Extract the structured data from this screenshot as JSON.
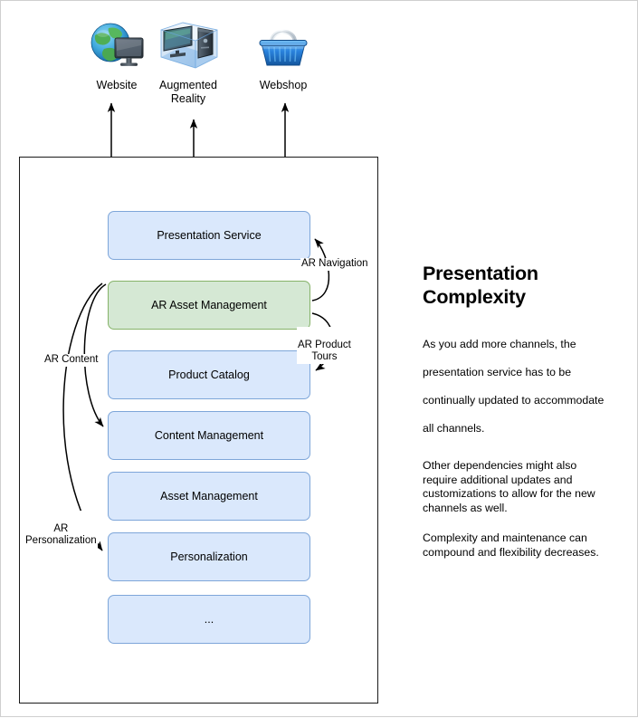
{
  "channels": [
    {
      "id": "website",
      "label": "Website",
      "icon": "globe-monitor-icon"
    },
    {
      "id": "ar",
      "label": "Augmented\nReality",
      "icon": "ar-projection-icon"
    },
    {
      "id": "webshop",
      "label": "Webshop",
      "icon": "shopping-basket-icon"
    }
  ],
  "services": [
    {
      "id": "presentation-service",
      "label": "Presentation Service",
      "highlight": false
    },
    {
      "id": "ar-asset-management",
      "label": "AR Asset Management",
      "highlight": true
    },
    {
      "id": "product-catalog",
      "label": "Product Catalog",
      "highlight": false
    },
    {
      "id": "content-management",
      "label": "Content Management",
      "highlight": false
    },
    {
      "id": "asset-management",
      "label": "Asset Management",
      "highlight": false
    },
    {
      "id": "personalization",
      "label": "Personalization",
      "highlight": false
    },
    {
      "id": "more",
      "label": "...",
      "highlight": false
    }
  ],
  "edges": [
    {
      "id": "ar-navigation",
      "label": "AR Navigation",
      "from": "ar-asset-management",
      "to": "presentation-service"
    },
    {
      "id": "ar-product-tours",
      "label": "AR Product\nTours",
      "from": "ar-asset-management",
      "to": "product-catalog"
    },
    {
      "id": "ar-content",
      "label": "AR Content",
      "from": "ar-asset-management",
      "to": "content-management"
    },
    {
      "id": "ar-personalization",
      "label": "AR\nPersonalization",
      "from": "ar-asset-management",
      "to": "personalization"
    }
  ],
  "panel": {
    "title_line1": "Presentation",
    "title_line2": "Complexity",
    "paragraph1": "As you add more channels, the presentation service has to be continually updated to accommodate all channels.",
    "paragraph2": "Other dependencies might also require additional updates and customizations to allow for the new channels as well.",
    "paragraph3": "Complexity and maintenance can compound and flexibility decreases."
  },
  "colors": {
    "box_fill": "#dae8fc",
    "box_border": "#7ea6d9",
    "highlight_fill": "#d5e8d4",
    "highlight_border": "#86b36a",
    "container_border": "#1a1a1a",
    "page_border": "#cfcfcf"
  }
}
